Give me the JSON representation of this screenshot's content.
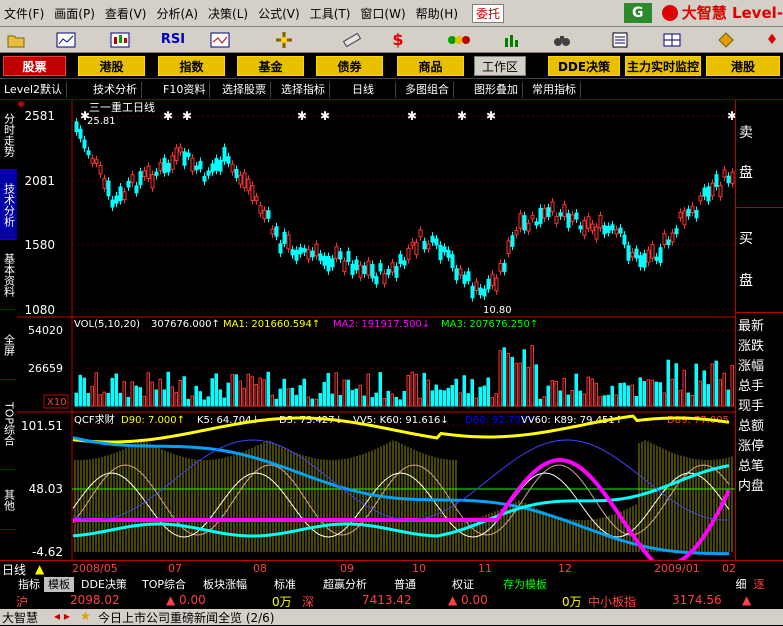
{
  "menu": [
    "文件(F)",
    "画面(P)",
    "查看(V)",
    "分析(A)",
    "决策(L)",
    "公式(V)",
    "工具(T)",
    "窗口(W)",
    "帮助(H)"
  ],
  "delegate": "委托",
  "brand": "大智慧 Level-",
  "nav": {
    "stock": "股票",
    "hk": "港股",
    "index": "指数",
    "fund": "基金",
    "bond": "债券",
    "goods": "商品",
    "workspace": "工作区",
    "dde": "DDE决策",
    "main_force": "主力实时监控",
    "hk2": "港股"
  },
  "subbar": [
    "Level2默认",
    "技术分析",
    "F10资料",
    "选择股票",
    "选择指标",
    "日线",
    "多图组合",
    "图形叠加",
    "常用指标"
  ],
  "side_tabs": [
    "分时走势",
    "技术分析",
    "基本资料",
    "全屏",
    "TOP综合",
    "其他"
  ],
  "right_panel": {
    "sell": "卖",
    "sell2": "盘",
    "buy": "买",
    "buy2": "盘",
    "items": [
      "最新",
      "涨跌",
      "涨幅",
      "总手",
      "现手",
      "总额",
      "涨停",
      "总笔",
      "内盘"
    ]
  },
  "price_panel": {
    "title": "三一重工日线",
    "y_ticks": [
      "2581",
      "2081",
      "1580",
      "1080"
    ],
    "high_mark": "25.81",
    "low_mark": "10.80"
  },
  "vol_panel": {
    "label": "VOL(5,10,20)",
    "value": "307676.000↑",
    "ma1": "MA1: 201660.594↑",
    "ma2": "MA2: 191917.500↓",
    "ma3": "MA3: 207676.250↑",
    "y_ticks": [
      "54020",
      "26659"
    ],
    "unit": "X10"
  },
  "qcf_panel": {
    "name": "QCF求财",
    "d90": "D90: 7.000↑",
    "k5": "K5: 64.704↓",
    "d5": "D5: 73.427↓",
    "vv5": "VV5: K60: 91.616↓",
    "d60": "D60: 92.705↓",
    "vv60": "VV60: K89: 79.451↑",
    "d89": "D89: 77.005",
    "y_ticks": [
      "101.51",
      "48.03",
      "-4.62"
    ]
  },
  "dates": {
    "period": "日线",
    "labels": [
      "2008/05",
      "07",
      "08",
      "09",
      "10",
      "11",
      "12",
      "2009/01",
      "02"
    ]
  },
  "tabs": [
    "指标",
    "模板",
    "DDE决策",
    "TOP综合",
    "板块涨幅",
    "标准",
    "超赢分析",
    "普通",
    "权证",
    "存为模板"
  ],
  "tabs_right": [
    "细",
    "逐"
  ],
  "index_bar": {
    "sh": "沪",
    "sh_val": "2098.02",
    "sh_chg": "▲ 0.00",
    "sh_vol": "0万",
    "sz": "深",
    "sz_val": "7413.42",
    "sz_chg": "▲ 0.00",
    "sz_vol": "0万",
    "sme": "中小板指",
    "sme_val": "3174.56",
    "sme_chg": "▲"
  },
  "news": {
    "brand": "大智慧",
    "text": "今日上市公司重磅新闻全览 (2/6)"
  },
  "colors": {
    "up": "#ff3232",
    "down": "#00ffff",
    "ma_yellow": "#ffff00",
    "accent": "#c00000"
  }
}
